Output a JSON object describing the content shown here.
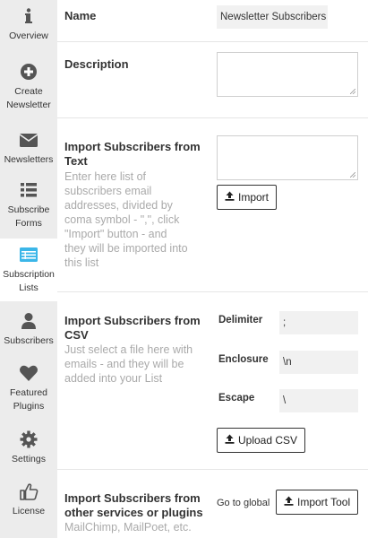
{
  "sidebar": {
    "items": [
      {
        "label_lines": [
          "Overview"
        ],
        "icon": "info-icon"
      },
      {
        "label_lines": [
          "Create",
          "Newsletter"
        ],
        "icon": "plus-circle-icon"
      },
      {
        "label_lines": [
          "Newsletters"
        ],
        "icon": "envelope-icon"
      },
      {
        "label_lines": [
          "Subscribe",
          "Forms"
        ],
        "icon": "list-icon"
      },
      {
        "label_lines": [
          "Subscription",
          "Lists"
        ],
        "icon": "table-list-icon",
        "active": true
      },
      {
        "label_lines": [
          "Subscribers"
        ],
        "icon": "user-icon"
      },
      {
        "label_lines": [
          "Featured",
          "Plugins"
        ],
        "icon": "heart-icon"
      },
      {
        "label_lines": [
          "Settings"
        ],
        "icon": "gear-icon"
      },
      {
        "label_lines": [
          "License"
        ],
        "icon": "thumbs-up-icon"
      }
    ],
    "active_color": "#3bb6e8",
    "icon_color": "#555555"
  },
  "form": {
    "name": {
      "label": "Name",
      "value": "Newsletter Subscribers"
    },
    "description": {
      "label": "Description",
      "value": ""
    },
    "import_text": {
      "title_lines": [
        "Import Subscribers from",
        "Text"
      ],
      "desc_lines": [
        "Enter here list of",
        "subscribers email",
        "addresses, divided by",
        "coma symbol - \",\", click",
        "\"Import\" button - and",
        "they will be imported into",
        "this list"
      ],
      "button": "Import"
    },
    "import_csv": {
      "title_lines": [
        "Import Subscribers from",
        "CSV"
      ],
      "desc_lines": [
        "Just select a file here with",
        "emails - and they will be",
        "added into your List"
      ],
      "delimiter_label": "Delimiter",
      "delimiter_value": ";",
      "enclosure_label": "Enclosure",
      "enclosure_value": "\\n",
      "escape_label": "Escape",
      "escape_value": "\\",
      "button": "Upload CSV"
    },
    "import_other": {
      "title_lines": [
        "Import Subscribers from",
        "other services or plugins"
      ],
      "desc_lines": [
        "MailChimp, MailPoet, etc."
      ],
      "goto_text": "Go to global",
      "button": "Import Tool"
    }
  }
}
